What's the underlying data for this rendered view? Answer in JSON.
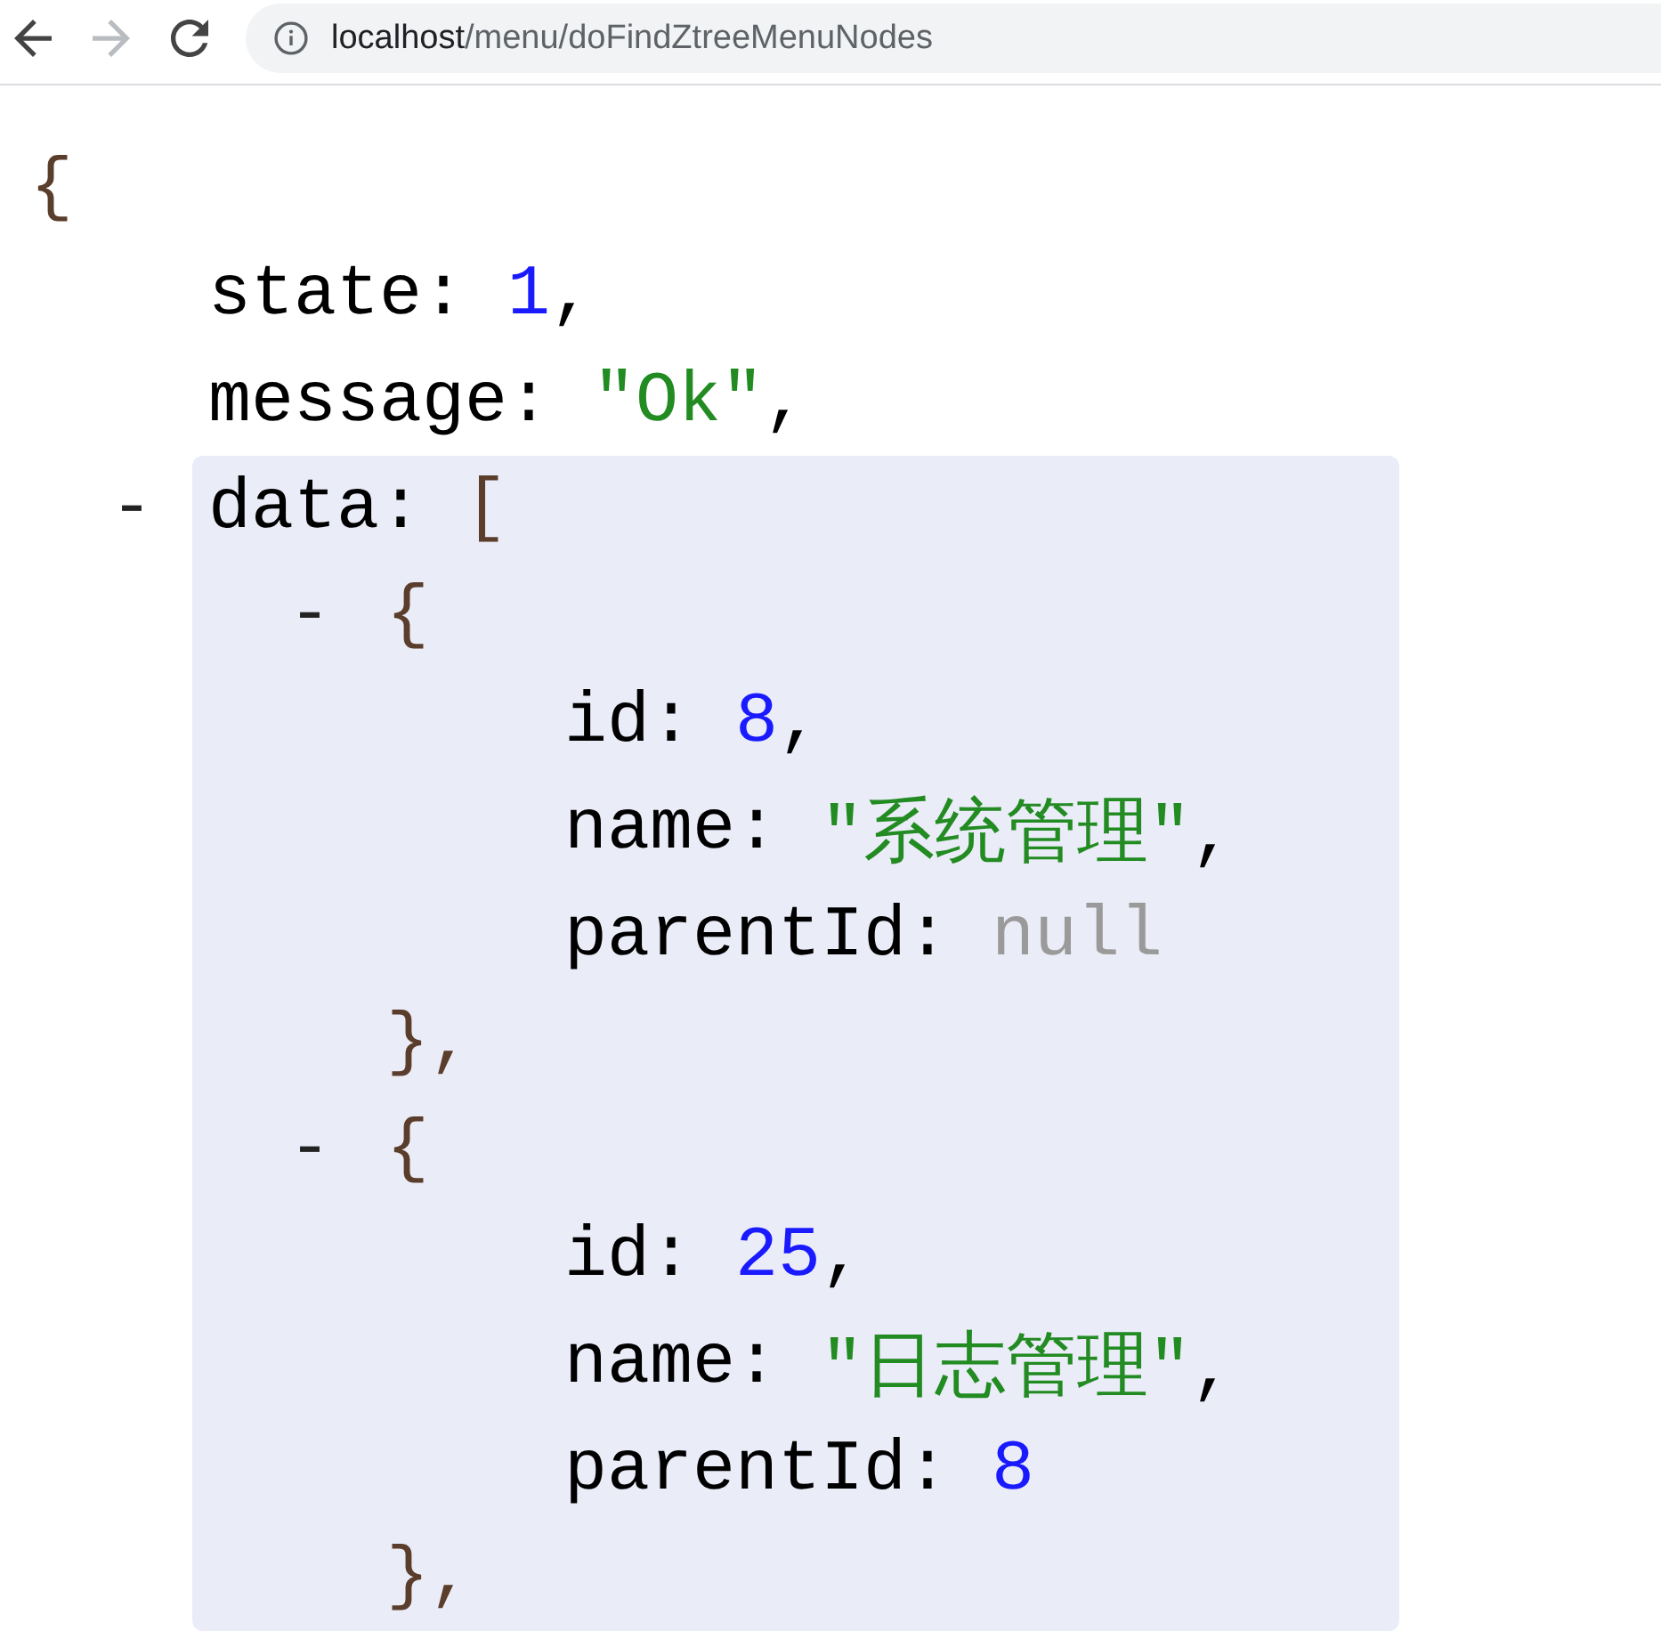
{
  "browser": {
    "nav_buttons": [
      {
        "kind": "back",
        "disabled": false
      },
      {
        "kind": "forward",
        "disabled": true
      },
      {
        "kind": "reload",
        "disabled": false
      }
    ],
    "address_bar": {
      "host": "localhost",
      "path": "/menu/doFindZtreeMenuNodes"
    }
  },
  "viewer": {
    "open": "{",
    "members": [
      {
        "kind": "number",
        "key": "state:",
        "value": "1",
        "comma": ","
      },
      {
        "kind": "string",
        "key": "message:",
        "value": "\"Ok\"",
        "comma": ","
      },
      {
        "kind": "array",
        "key": "data:",
        "toggle": "-",
        "expanded": true,
        "highlighted": true,
        "open": "[",
        "items": [
          {
            "kind": "object",
            "toggle": "-",
            "expanded": true,
            "open": "{",
            "close": "}",
            "comma": ",",
            "members": [
              {
                "kind": "number",
                "key": "id:",
                "value": "8",
                "comma": ","
              },
              {
                "kind": "string",
                "key": "name:",
                "value": "\"系统管理\"",
                "comma": ","
              },
              {
                "kind": "null",
                "key": "parentId:",
                "value": "null"
              }
            ]
          },
          {
            "kind": "object",
            "toggle": "-",
            "expanded": true,
            "open": "{",
            "close": "}",
            "comma": ",",
            "members": [
              {
                "kind": "number",
                "key": "id:",
                "value": "25",
                "comma": ","
              },
              {
                "kind": "string",
                "key": "name:",
                "value": "\"日志管理\"",
                "comma": ","
              },
              {
                "kind": "number",
                "key": "parentId:",
                "value": "8"
              }
            ]
          }
        ]
      }
    ]
  }
}
